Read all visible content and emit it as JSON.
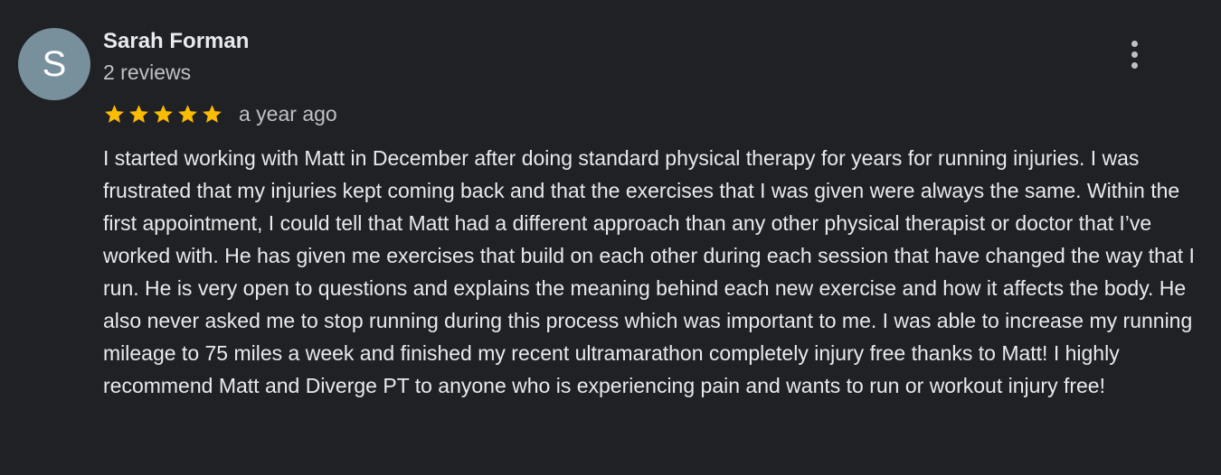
{
  "author": {
    "initial": "S",
    "name": "Sarah Forman",
    "review_count": "2 reviews",
    "avatar_color": "#78909c"
  },
  "rating": {
    "stars": 5,
    "max_stars": 5,
    "star_color": "#fbbc04",
    "date": "a year ago"
  },
  "menu": {
    "icon": "more-vert-icon"
  },
  "review": {
    "text": "I started working with Matt in December after doing standard physical therapy for years for running injuries. I was frustrated that my injuries kept coming back and that the exercises that I was given were always the same. Within the first appointment, I could tell that Matt had a different approach than any other physical therapist or doctor that I’ve worked with. He has given me exercises that build on each other during each session that have changed the way that I run. He is very open to questions and explains the meaning behind each new exercise and how it affects the body. He also never asked me to stop running during this process which was important to me. I was able to increase my running mileage to 75 miles a week and finished my recent ultramarathon completely injury free thanks to Matt! I highly recommend Matt and Diverge PT to anyone who is experiencing pain and wants to run or workout injury free!"
  }
}
